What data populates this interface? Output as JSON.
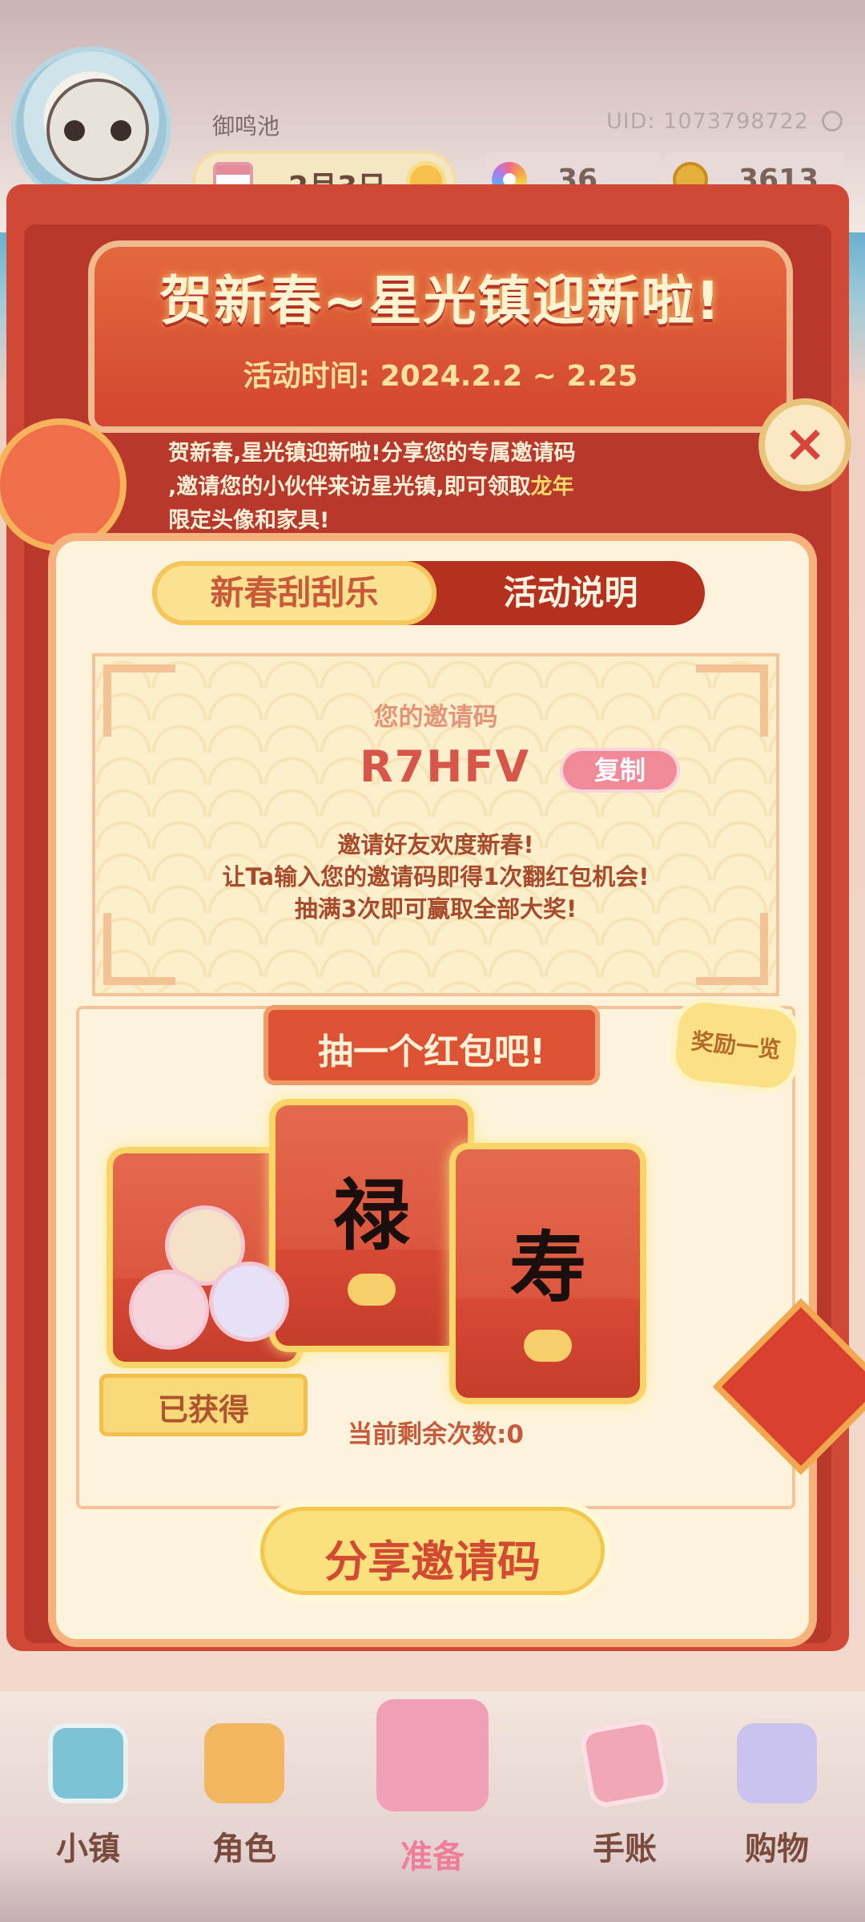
{
  "header": {
    "nickname": "御鸣池",
    "uid": "UID: 1073798722",
    "date": "2月3日",
    "currencies": [
      {
        "icon": "rainbow-flower-icon",
        "value": "36"
      },
      {
        "icon": "gold-coin-icon",
        "value": "3613"
      }
    ]
  },
  "event": {
    "title": "贺新春~星光镇迎新啦!",
    "time": "活动时间: 2024.2.2 ~ 2.25",
    "intro_lines": [
      "贺新春,星光镇迎新啦!分享您的专属邀请码",
      ",邀请您的小伙伴来访星光镇,即可领取"
    ],
    "intro_highlight": "龙年",
    "intro_tail": "限定头像和家具!",
    "close_label": "×"
  },
  "tabs": [
    {
      "label": "新春刮刮乐",
      "active": true
    },
    {
      "label": "活动说明",
      "active": false
    }
  ],
  "invite": {
    "label": "您的邀请码",
    "code": "R7HFV",
    "copy_label": "复制",
    "rules": [
      "邀请好友欢度新春!",
      "让Ta输入您的邀请码即得1次翻红包机会!",
      "抽满3次即可赢取全部大奖!"
    ]
  },
  "draw": {
    "banner": "抽一个红包吧!",
    "reward_list_label": "奖励一览",
    "envelopes": [
      {
        "state": "opened",
        "badge": "已获得"
      },
      {
        "state": "closed",
        "character": "禄"
      },
      {
        "state": "closed",
        "character": "寿"
      }
    ],
    "remaining_text": "当前剩余次数:0"
  },
  "share_button": "分享邀请码",
  "bottom_nav": [
    {
      "label": "小镇",
      "icon": "map-icon",
      "active": false
    },
    {
      "label": "角色",
      "icon": "character-icon",
      "active": false
    },
    {
      "label": "准备",
      "icon": "picnic-basket-icon",
      "active": true
    },
    {
      "label": "手账",
      "icon": "journal-icon",
      "active": false
    },
    {
      "label": "购物",
      "icon": "shopping-bag-icon",
      "active": false
    }
  ],
  "colors": {
    "frame_red": "#d04936",
    "card_cream": "#fdf3dc",
    "gold": "#fbe07e",
    "nav_active": "#f07e9a"
  }
}
